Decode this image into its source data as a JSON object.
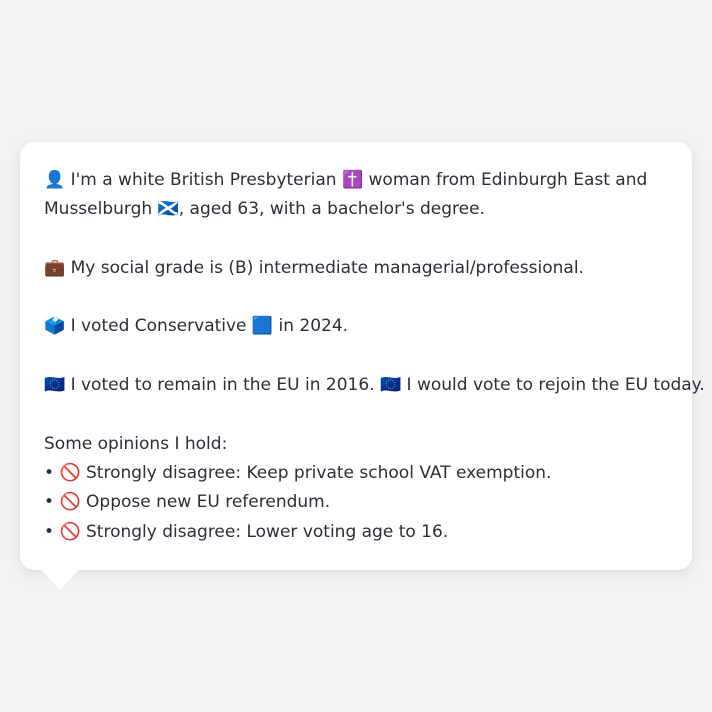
{
  "bubble": {
    "identity": {
      "icon": "👤",
      "text_1": "I'm a white British Presbyterian",
      "religion_icon": "✝️",
      "text_2": "woman from Edinburgh East and Musselburgh",
      "flag_icon": "🏴󠁧󠁢󠁳󠁣󠁴󠁿",
      "text_3": ", aged 63, with a bachelor's degree."
    },
    "social_grade": {
      "icon": "💼",
      "text": "My social grade is (B) intermediate managerial/professional."
    },
    "vote_2024": {
      "icon": "🗳️",
      "text_1": "I voted Conservative",
      "party_icon": "🟦",
      "text_2": "in 2024."
    },
    "eu": {
      "icon_1": "🇪🇺",
      "text_1": "I voted to remain in the EU in 2016.",
      "icon_2": "🇪🇺",
      "text_2": "I would vote to rejoin the EU today."
    },
    "opinions": {
      "heading": "Some opinions I hold:",
      "bullet": "•",
      "items": [
        {
          "icon": "🚫",
          "text": "Strongly disagree: Keep private school VAT exemption."
        },
        {
          "icon": "🚫",
          "text": "Oppose new EU referendum."
        },
        {
          "icon": "🚫",
          "text": "Strongly disagree: Lower voting age to 16."
        }
      ]
    }
  },
  "colors": {
    "background": "#f2f3f5",
    "bubble": "#ffffff",
    "text": "#2b2f36"
  }
}
